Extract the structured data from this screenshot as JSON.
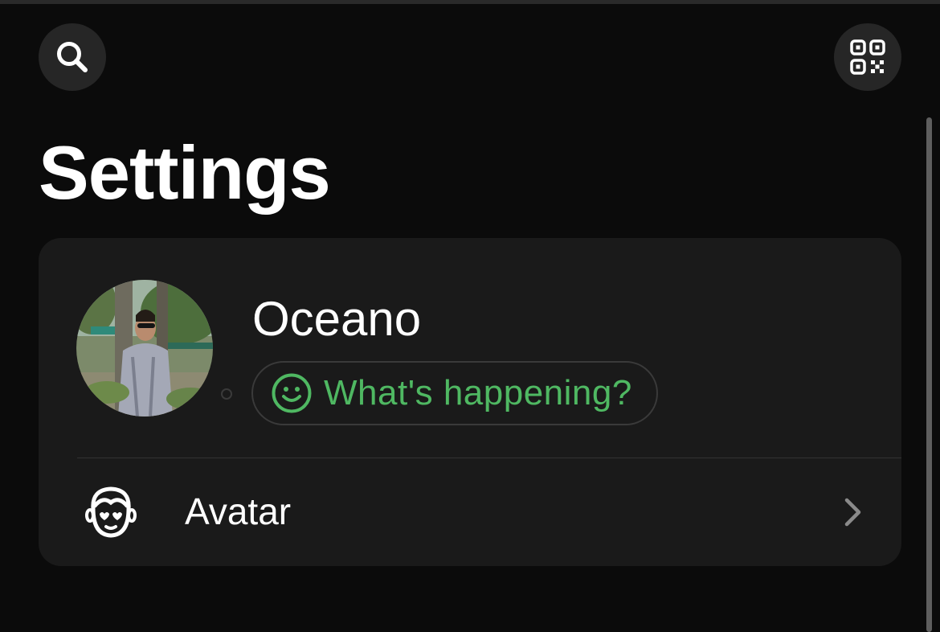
{
  "header": {
    "search_icon": "search-icon",
    "qr_icon": "qr-code-icon",
    "title": "Settings"
  },
  "profile": {
    "name": "Oceano",
    "status_placeholder": "What's happening?",
    "status_icon": "smiley-icon",
    "status_color": "#4fb862",
    "photo_icon": "profile-photo"
  },
  "menu": {
    "items": [
      {
        "label": "Avatar",
        "icon": "avatar-face-icon",
        "chevron": "chevron-right-icon"
      }
    ]
  },
  "colors": {
    "background": "#0b0b0b",
    "card": "#1a1a1a",
    "button": "#262626",
    "accent": "#4fb862"
  }
}
